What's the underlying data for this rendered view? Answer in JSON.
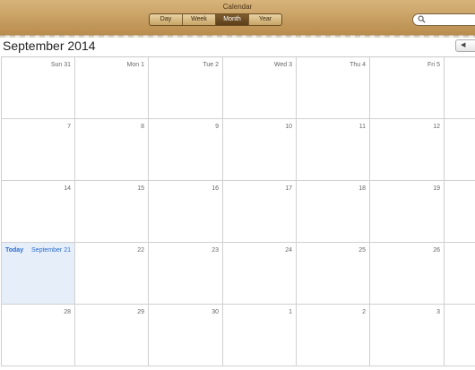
{
  "window": {
    "title": "Calendar"
  },
  "toolbar": {
    "views": [
      {
        "label": "Day",
        "active": false
      },
      {
        "label": "Week",
        "active": false
      },
      {
        "label": "Month",
        "active": true
      },
      {
        "label": "Year",
        "active": false
      }
    ],
    "search_placeholder": ""
  },
  "header": {
    "month_title": "September 2014",
    "prev_icon": "◀"
  },
  "today": {
    "label": "Today"
  },
  "weeks": [
    [
      "Sun 31",
      "Mon 1",
      "Tue 2",
      "Wed 3",
      "Thu 4",
      "Fri 5",
      ""
    ],
    [
      "7",
      "8",
      "9",
      "10",
      "11",
      "12",
      ""
    ],
    [
      "14",
      "15",
      "16",
      "17",
      "18",
      "19",
      ""
    ],
    [
      "September 21",
      "22",
      "23",
      "24",
      "25",
      "26",
      ""
    ],
    [
      "28",
      "29",
      "30",
      "1",
      "2",
      "3",
      ""
    ]
  ],
  "colors": {
    "toolbar": "#c9a05f",
    "today_bg": "#e6eef9",
    "accent": "#2a6dcf"
  }
}
